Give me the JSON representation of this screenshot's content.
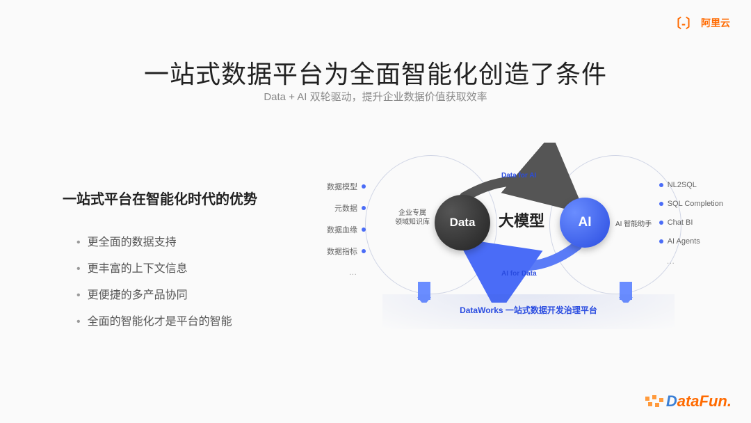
{
  "brand_top": {
    "name": "阿里云"
  },
  "title": "一站式数据平台为全面智能化创造了条件",
  "subtitle": "Data + AI 双轮驱动，提升企业数据价值获取效率",
  "section_heading": "一站式平台在智能化时代的优势",
  "bullets": [
    "更全面的数据支持",
    "更丰富的上下文信息",
    "更便捷的多产品协同",
    "全面的智能化才是平台的智能"
  ],
  "diagram": {
    "left_items": [
      "数据模型",
      "元数据",
      "数据血缘",
      "数据指标"
    ],
    "right_items": [
      "NL2SQL",
      "SQL Completion",
      "Chat BI",
      "AI Agents"
    ],
    "left_sub": "企业专属\n领域知识库",
    "right_sub": "AI 智能助手",
    "data_node": "Data",
    "ai_node": "AI",
    "center": "大模型",
    "flow_top": "Data for AI",
    "flow_bot": "AI for Data",
    "footer": "DataWorks  一站式数据开发治理平台"
  },
  "footer_brand": "DataFun."
}
